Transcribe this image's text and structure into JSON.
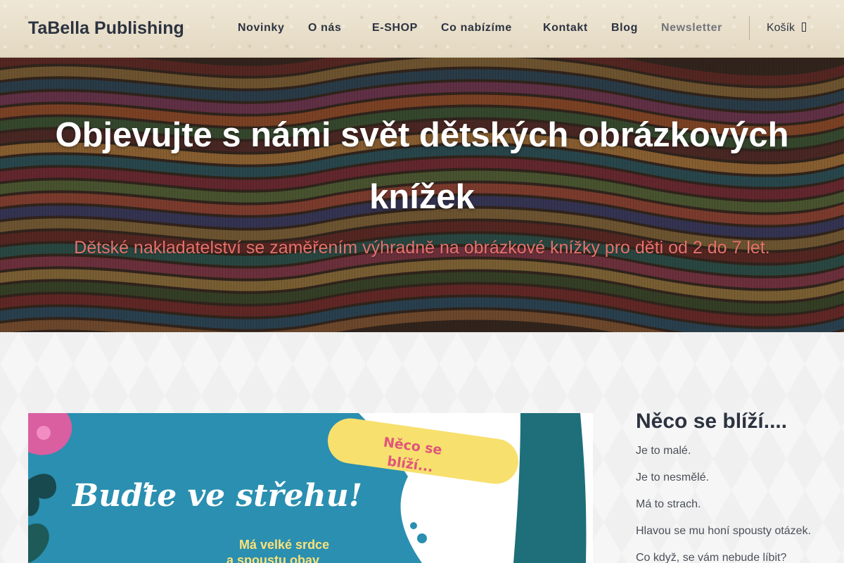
{
  "header": {
    "brand": "TaBella Publishing",
    "nav": [
      {
        "label": "Novinky",
        "has_dropdown": false
      },
      {
        "label": "O nás",
        "has_dropdown": true
      },
      {
        "label": "E-SHOP",
        "has_dropdown": false
      },
      {
        "label": "Co nabízíme",
        "has_dropdown": true
      },
      {
        "label": "Kontakt",
        "has_dropdown": false
      },
      {
        "label": "Blog",
        "has_dropdown": false
      },
      {
        "label": "Newsletter",
        "has_dropdown": false
      }
    ],
    "cart_label": "Košík",
    "cart_icon": "shopping-bag-icon"
  },
  "hero": {
    "title": "Objevujte s námi svět dětských obrázkových knížek",
    "subtitle": "Dětské nakladatelství se zaměřením výhradně na obrázkové knížky pro děti od 2 do 7 let."
  },
  "feature": {
    "badge_text": "Něco se blíží...",
    "title": "Buďte ve střehu!",
    "line1": "Má velké srdce",
    "line2": "a spoustu obav"
  },
  "sidebar": {
    "title": "Něco se blíží....",
    "lines": [
      "Je to malé.",
      "Je to nesmělé.",
      "Má to strach.",
      "Hlavou se mu honí spousty otázek.",
      "Co když, se vám nebude líbit?"
    ]
  },
  "colors": {
    "brand_text": "#2c3340",
    "subtitle": "#e7726c",
    "feature_bg": "#2a8fb0",
    "badge": "#f7e06e",
    "badge_text": "#e0567a"
  }
}
